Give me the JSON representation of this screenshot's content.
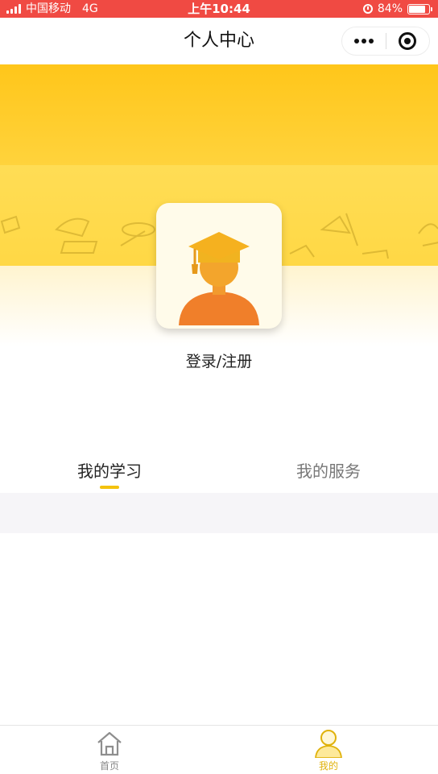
{
  "status_bar": {
    "carrier": "中国移动",
    "network": "4G",
    "time": "上午10:44",
    "battery": "84%",
    "battery_level": 0.84
  },
  "nav": {
    "title": "个人中心",
    "more_icon": "more-dots-icon",
    "close_icon": "target-circle-icon"
  },
  "profile": {
    "avatar_icon": "graduate-avatar-icon",
    "login_label": "登录/注册"
  },
  "tabs": [
    {
      "label": "我的学习",
      "active": true
    },
    {
      "label": "我的服务",
      "active": false
    }
  ],
  "tabbar": [
    {
      "label": "首页",
      "icon": "home-icon",
      "active": false
    },
    {
      "label": "我的",
      "icon": "user-icon",
      "active": true
    }
  ],
  "colors": {
    "status_bar": "#f04a43",
    "accent": "#f4c20d",
    "banner_top": "#ffc719",
    "avatar_orange": "#f07f2a"
  }
}
